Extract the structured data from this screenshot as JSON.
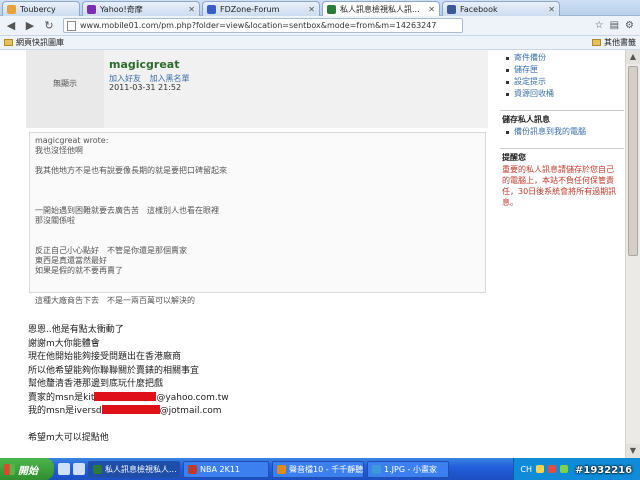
{
  "browser": {
    "tabs": [
      {
        "label": "Toubercy",
        "color": "#e8a23c",
        "active": false
      },
      {
        "label": "Yahoo!奇摩",
        "color": "#7b2fb0",
        "active": false
      },
      {
        "label": "FDZone-Forum",
        "color": "#3a5cc8",
        "active": false
      },
      {
        "label": "私人訊息檢視私人訊...",
        "color": "#2c7a3a",
        "active": true
      },
      {
        "label": "Facebook",
        "color": "#3b5998",
        "active": false
      }
    ],
    "url": "www.mobile01.com/pm.php?folder=view&location=sentbox&mode=from&m=14263247",
    "bookmark_folder": "網頁快訊圖庫",
    "bookmark_other": "其他書籤"
  },
  "message": {
    "avatar_label": "無顯示",
    "author": "magicgreat",
    "actions": [
      "加入好友",
      "加入黑名單"
    ],
    "timestamp": "2011-03-31 21:52",
    "quote_lines": [
      "magicgreat wrote:",
      "我也沒怪他啊",
      "",
      "我其他地方不是也有說要像長期的就是要把口碑留起來",
      "",
      "",
      "",
      "一開始遇到困難就要去廣告苦　這樣別人也看在眼裡",
      "那沒關係啦",
      "",
      "",
      "反正自己小心點好　不管是你還是那個賣家",
      "東西是真還當然最好",
      "如果是假的就不要再賣了",
      "",
      "",
      "這種大廠商告下去　不是一兩百萬可以解決的"
    ],
    "body_lines": [
      "恩恩..他是有點太衝動了",
      "謝謝m大你能體會",
      "現在他開始能夠接受問題出在香港廠商",
      "所以他希望能夠你聯聯關於賣錶的相關事宜",
      "幫他釐清香港那邊到底玩什麼把戲"
    ],
    "msn_line1": {
      "prefix": "賣家的msn是kit",
      "suffix": "@yahoo.com.tw"
    },
    "msn_line2": {
      "prefix": "我的msn是iversd",
      "suffix": "@jotmail.com"
    },
    "closing": "希望m大可以提點他"
  },
  "sidebar": {
    "top_items": [
      "寄件備份",
      "儲存匣",
      "設定提示",
      "資源回收桶"
    ],
    "save_title": "儲存私人訊息",
    "save_item": "備份訊息到我的電腦",
    "warn_title": "提醒您",
    "warn_text": "重要的私人訊息請儲存於您自己的電腦上，本站不負任何保管責任，30日後系統會將所有過期訊息。"
  },
  "taskbar": {
    "start": "開始",
    "tasks": [
      {
        "label": "私人訊息檢視私人...",
        "color": "#2c7a3a",
        "active": true
      },
      {
        "label": "NBA 2K11",
        "color": "#c0392b",
        "active": false
      },
      {
        "label": "聲音檔10 - 千千靜聽",
        "color": "#e08a1e",
        "active": false
      },
      {
        "label": "1.JPG - 小畫家",
        "color": "#3c9ad8",
        "active": false
      }
    ],
    "ime": "CH",
    "watermark": "#1932216"
  }
}
